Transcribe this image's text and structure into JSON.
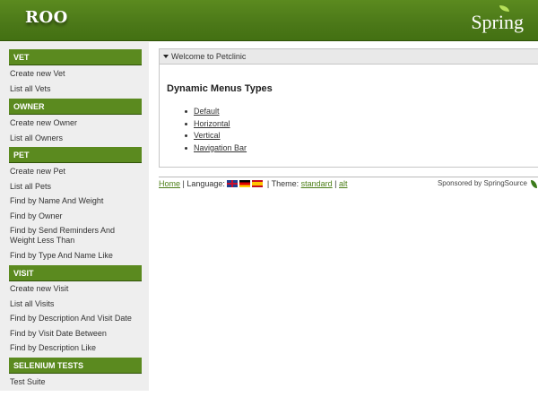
{
  "header": {
    "app_logo": "ROO",
    "brand_logo": "Spring"
  },
  "sidebar": {
    "sections": [
      {
        "title": "VET",
        "items": [
          "Create new Vet",
          "List all Vets"
        ]
      },
      {
        "title": "OWNER",
        "items": [
          "Create new Owner",
          "List all Owners"
        ]
      },
      {
        "title": "PET",
        "items": [
          "Create new Pet",
          "List all Pets",
          "Find by Name And Weight",
          "Find by Owner",
          "Find by Send Reminders And Weight Less Than",
          "Find by Type And Name Like"
        ]
      },
      {
        "title": "VISIT",
        "items": [
          "Create new Visit",
          "List all Visits",
          "Find by Description And Visit Date",
          "Find by Visit Date Between",
          "Find by Description Like"
        ]
      },
      {
        "title": "SELENIUM TESTS",
        "items": [
          "Test Suite"
        ]
      }
    ]
  },
  "panel": {
    "title": "Welcome to Petclinic",
    "heading": "Dynamic Menus Types",
    "menu_types": [
      "Default",
      "Horizontal",
      "Vertical",
      "Navigation Bar"
    ]
  },
  "footer": {
    "home": "Home",
    "separator1": " | Language: ",
    "separator2": " | Theme: ",
    "theme_standard": "standard",
    "separator3": " | ",
    "theme_alt": "alt",
    "sponsored": "Sponsored by SpringSource"
  },
  "icons": {
    "flags": [
      "flag-en-icon",
      "flag-de-icon",
      "flag-es-icon"
    ]
  },
  "colors": {
    "brand_green": "#5b8a1f",
    "link_green": "#4d7f18",
    "sidebar_bg": "#eeeeee"
  }
}
